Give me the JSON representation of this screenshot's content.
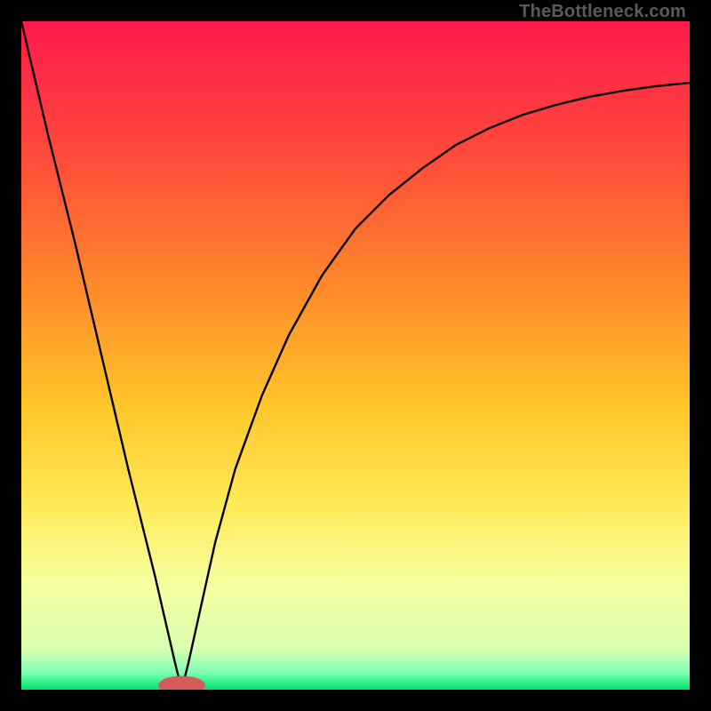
{
  "attribution": "TheBottleneck.com",
  "chart_data": {
    "type": "line",
    "title": "",
    "xlabel": "",
    "ylabel": "",
    "xlim": [
      0,
      100
    ],
    "ylim": [
      0,
      100
    ],
    "background_gradient": {
      "top": "#ff1a4b",
      "upper_mid": "#ff7a2a",
      "mid": "#ffc72a",
      "lower_mid": "#ffe955",
      "lower": "#f7ff9f",
      "bottom_strip": "#00e36b"
    },
    "gradient_stops": [
      {
        "offset": 0.0,
        "color": "#ff1a4b"
      },
      {
        "offset": 0.2,
        "color": "#ff4a3a"
      },
      {
        "offset": 0.4,
        "color": "#ff8a2a"
      },
      {
        "offset": 0.58,
        "color": "#ffc72a"
      },
      {
        "offset": 0.72,
        "color": "#ffe955"
      },
      {
        "offset": 0.84,
        "color": "#f7ff9f"
      },
      {
        "offset": 0.94,
        "color": "#d8ffb0"
      },
      {
        "offset": 0.975,
        "color": "#7affb4"
      },
      {
        "offset": 1.0,
        "color": "#00e36b"
      }
    ],
    "marker": {
      "x": 24,
      "y": 0,
      "color": "#d65a5a",
      "rx": 3.5,
      "ry": 1.4
    },
    "series": [
      {
        "name": "curve",
        "color": "#000000",
        "x": [
          0,
          4,
          8,
          12,
          16,
          20,
          23,
          24,
          25,
          27,
          29,
          32,
          36,
          40,
          45,
          50,
          55,
          60,
          65,
          70,
          75,
          80,
          85,
          90,
          95,
          100
        ],
        "y": [
          100,
          83,
          67,
          50,
          33,
          17,
          4,
          0,
          4,
          13,
          22,
          33,
          44,
          53,
          62,
          69,
          74,
          78,
          81.5,
          84,
          86,
          87.5,
          88.7,
          89.6,
          90.3,
          90.8
        ]
      }
    ]
  }
}
